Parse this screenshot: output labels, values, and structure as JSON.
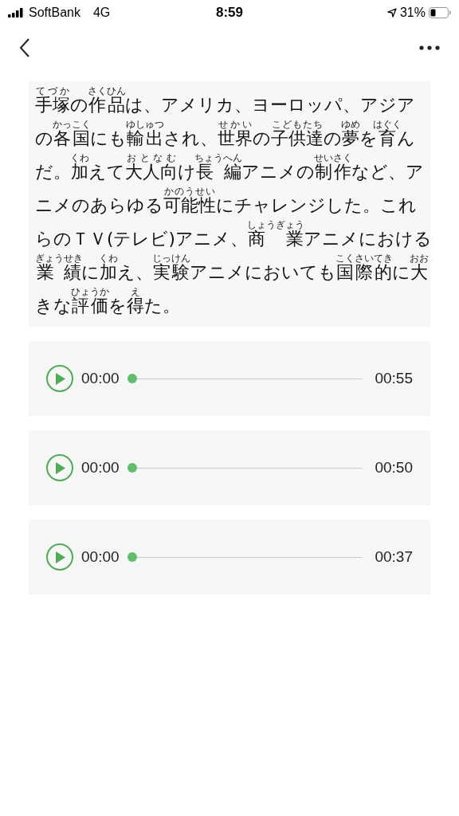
{
  "status_bar": {
    "carrier": "SoftBank",
    "network": "4G",
    "time": "8:59",
    "battery": "31%"
  },
  "passage": {
    "lines": [
      [
        {
          "text": "手塚",
          "ruby": "てづか"
        },
        {
          "text": "の"
        },
        {
          "text": "作品",
          "ruby": "さくひん"
        },
        {
          "text": "は、アメリカ、ヨーロッパ、アジア"
        }
      ],
      [
        {
          "text": "の"
        },
        {
          "text": "各国",
          "ruby": "かっこく"
        },
        {
          "text": "にも"
        },
        {
          "text": "輸出",
          "ruby": "ゆしゅつ"
        },
        {
          "text": "され、"
        },
        {
          "text": "世界",
          "ruby": "せかい"
        },
        {
          "text": "の"
        },
        {
          "text": "子供達",
          "ruby": "こどもたち"
        },
        {
          "text": "の"
        },
        {
          "text": "夢",
          "ruby": "ゆめ"
        },
        {
          "text": "を"
        },
        {
          "text": "育",
          "ruby": "はぐく"
        },
        {
          "text": "ん"
        }
      ],
      [
        {
          "text": "だ。"
        },
        {
          "text": "加",
          "ruby": "くわ"
        },
        {
          "text": "えて"
        },
        {
          "text": "大人向",
          "ruby": "おとなむ"
        },
        {
          "text": "け"
        },
        {
          "text": "長 編",
          "ruby": "ちょうへん"
        },
        {
          "text": "アニメの"
        },
        {
          "text": "制作",
          "ruby": "せいさく"
        },
        {
          "text": "など、ア"
        }
      ],
      [
        {
          "text": "ニメのあらゆる"
        },
        {
          "text": "可能性",
          "ruby": "かのうせい"
        },
        {
          "text": "にチャレンジした。これ"
        }
      ],
      [
        {
          "text": "らのＴＶ(テレビ)アニメ、"
        },
        {
          "text": "商　業",
          "ruby": "しょうぎょう"
        },
        {
          "text": "アニメにおける"
        }
      ],
      [
        {
          "text": "業 績",
          "ruby": "ぎょうせき"
        },
        {
          "text": "に"
        },
        {
          "text": "加",
          "ruby": "くわ"
        },
        {
          "text": "え、"
        },
        {
          "text": "実験",
          "ruby": "じっけん"
        },
        {
          "text": "アニメにおいても"
        },
        {
          "text": "国際的",
          "ruby": "こくさいてき"
        },
        {
          "text": "に"
        },
        {
          "text": "大",
          "ruby": "おお"
        }
      ],
      [
        {
          "text": "きな"
        },
        {
          "text": "評価",
          "ruby": "ひょうか"
        },
        {
          "text": "を"
        },
        {
          "text": "得",
          "ruby": "え"
        },
        {
          "text": "た。"
        }
      ]
    ]
  },
  "players": [
    {
      "current": "00:00",
      "duration": "00:55",
      "level": 0
    },
    {
      "current": "00:00",
      "duration": "00:50",
      "level": 0
    },
    {
      "current": "00:00",
      "duration": "00:37",
      "level": 0
    }
  ]
}
